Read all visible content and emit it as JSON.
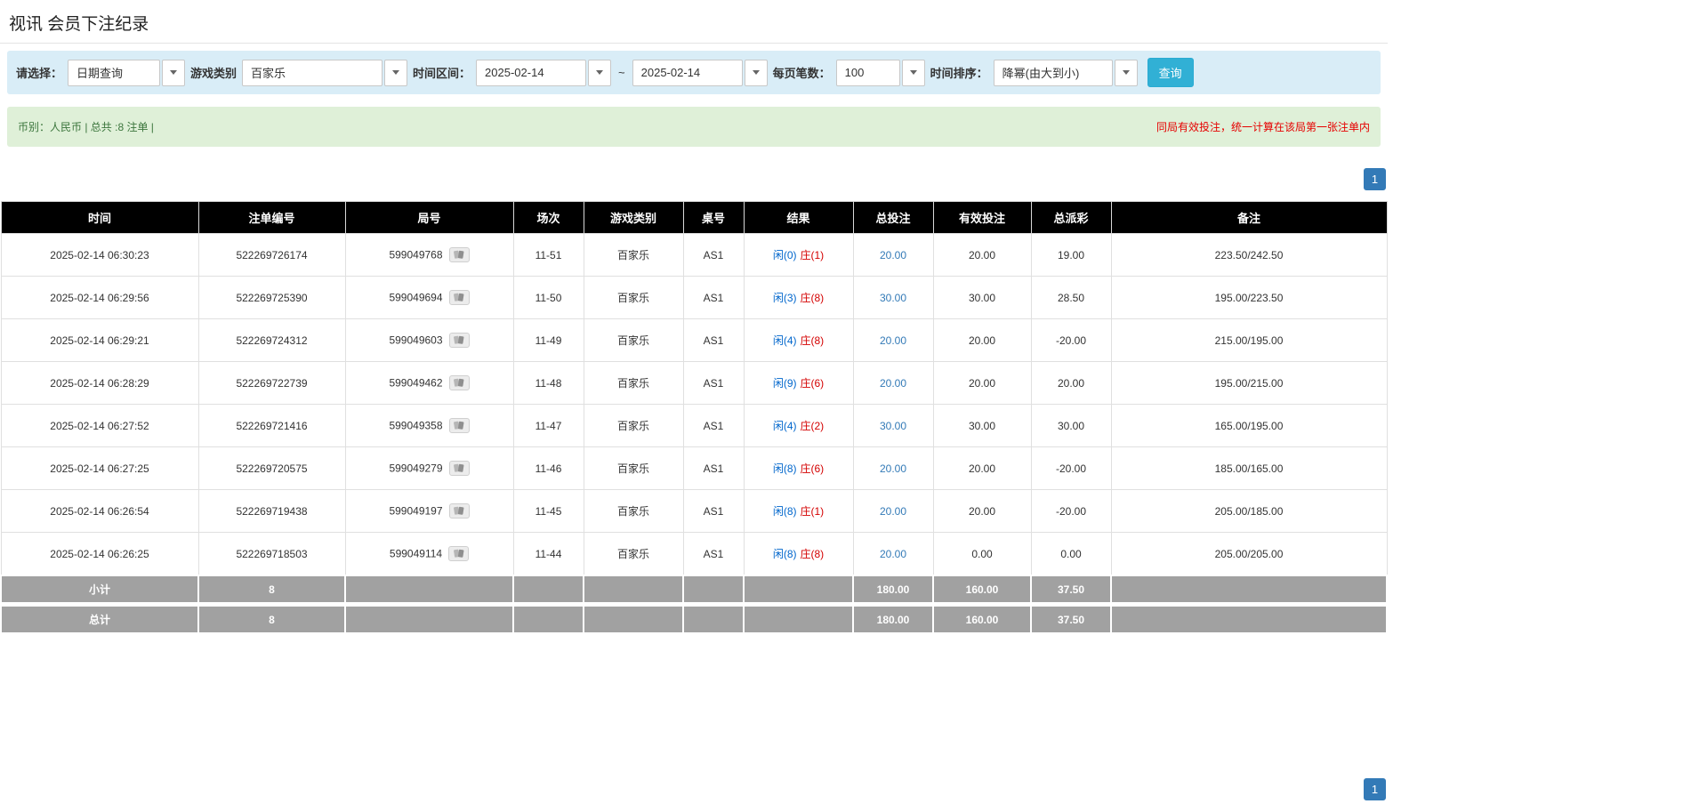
{
  "page": {
    "title": "视讯 会员下注纪录"
  },
  "filters": {
    "query_type_label": "请选择：",
    "query_type_value": "日期查询",
    "game_type_label": "游戏类别",
    "game_type_value": "百家乐",
    "time_range_label": "时间区间：",
    "date_from": "2025-02-14",
    "range_separator": "~",
    "date_to": "2025-02-14",
    "page_size_label": "每页笔数：",
    "page_size_value": "100",
    "sort_label": "时间排序：",
    "sort_value": "降幂(由大到小)",
    "search_button_label": "查询"
  },
  "info_bar": {
    "summary": "币别：人民币 | 总共 :8 注单 |",
    "notice": "同局有效投注，统一计算在该局第一张注单内"
  },
  "pagination": {
    "current_page": "1"
  },
  "table": {
    "headers": {
      "time": "时间",
      "bet_id": "注单编号",
      "round_id": "局号",
      "session": "场次",
      "game_type": "游戏类别",
      "table_no": "桌号",
      "result": "结果",
      "total_bet": "总投注",
      "valid_bet": "有效投注",
      "payout": "总派彩",
      "remark": "备注"
    },
    "rows": [
      {
        "time": "2025-02-14 06:30:23",
        "bet_id": "522269726174",
        "round_id": "599049768",
        "session": "11-51",
        "game_type": "百家乐",
        "table_no": "AS1",
        "result_player": "闲(0)",
        "result_banker": "庄(1)",
        "total_bet": "20.00",
        "valid_bet": "20.00",
        "payout": "19.00",
        "remark": "223.50/242.50"
      },
      {
        "time": "2025-02-14 06:29:56",
        "bet_id": "522269725390",
        "round_id": "599049694",
        "session": "11-50",
        "game_type": "百家乐",
        "table_no": "AS1",
        "result_player": "闲(3)",
        "result_banker": "庄(8)",
        "total_bet": "30.00",
        "valid_bet": "30.00",
        "payout": "28.50",
        "remark": "195.00/223.50"
      },
      {
        "time": "2025-02-14 06:29:21",
        "bet_id": "522269724312",
        "round_id": "599049603",
        "session": "11-49",
        "game_type": "百家乐",
        "table_no": "AS1",
        "result_player": "闲(4)",
        "result_banker": "庄(8)",
        "total_bet": "20.00",
        "valid_bet": "20.00",
        "payout": "-20.00",
        "remark": "215.00/195.00"
      },
      {
        "time": "2025-02-14 06:28:29",
        "bet_id": "522269722739",
        "round_id": "599049462",
        "session": "11-48",
        "game_type": "百家乐",
        "table_no": "AS1",
        "result_player": "闲(9)",
        "result_banker": "庄(6)",
        "total_bet": "20.00",
        "valid_bet": "20.00",
        "payout": "20.00",
        "remark": "195.00/215.00"
      },
      {
        "time": "2025-02-14 06:27:52",
        "bet_id": "522269721416",
        "round_id": "599049358",
        "session": "11-47",
        "game_type": "百家乐",
        "table_no": "AS1",
        "result_player": "闲(4)",
        "result_banker": "庄(2)",
        "total_bet": "30.00",
        "valid_bet": "30.00",
        "payout": "30.00",
        "remark": "165.00/195.00"
      },
      {
        "time": "2025-02-14 06:27:25",
        "bet_id": "522269720575",
        "round_id": "599049279",
        "session": "11-46",
        "game_type": "百家乐",
        "table_no": "AS1",
        "result_player": "闲(8)",
        "result_banker": "庄(6)",
        "total_bet": "20.00",
        "valid_bet": "20.00",
        "payout": "-20.00",
        "remark": "185.00/165.00"
      },
      {
        "time": "2025-02-14 06:26:54",
        "bet_id": "522269719438",
        "round_id": "599049197",
        "session": "11-45",
        "game_type": "百家乐",
        "table_no": "AS1",
        "result_player": "闲(8)",
        "result_banker": "庄(1)",
        "total_bet": "20.00",
        "valid_bet": "20.00",
        "payout": "-20.00",
        "remark": "205.00/185.00"
      },
      {
        "time": "2025-02-14 06:26:25",
        "bet_id": "522269718503",
        "round_id": "599049114",
        "session": "11-44",
        "game_type": "百家乐",
        "table_no": "AS1",
        "result_player": "闲(8)",
        "result_banker": "庄(8)",
        "total_bet": "20.00",
        "valid_bet": "0.00",
        "payout": "0.00",
        "remark": "205.00/205.00"
      }
    ],
    "subtotal": {
      "label": "小计",
      "count": "8",
      "total_bet": "180.00",
      "valid_bet": "160.00",
      "payout": "37.50"
    },
    "grand_total": {
      "label": "总计",
      "count": "8",
      "total_bet": "180.00",
      "valid_bet": "160.00",
      "payout": "37.50"
    }
  },
  "colors": {
    "accent_blue": "#337ab7",
    "result_player_blue": "#0066cc",
    "result_banker_red": "#d40000",
    "negative_red": "#d40000",
    "notice_red": "#e60000",
    "filter_bar_bg": "#d9edf7",
    "info_bar_bg": "#dff0d8",
    "table_header_bg": "#000000",
    "total_row_bg": "#a1a1a1",
    "search_button_bg": "#31b0d5"
  }
}
